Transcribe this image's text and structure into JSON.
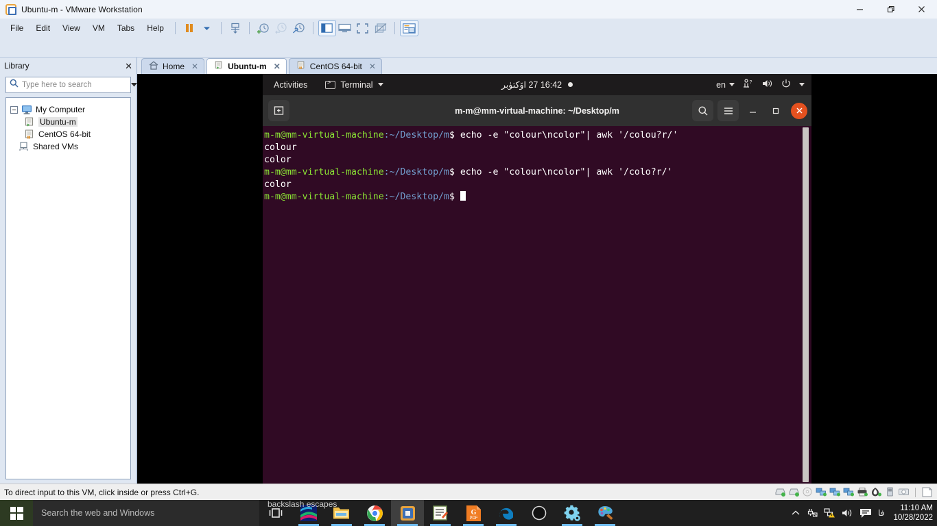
{
  "window": {
    "title": "Ubuntu-m - VMware Workstation",
    "icon": "vmware-icon",
    "controls": {
      "minimize": "minimize-icon",
      "restore": "restore-icon",
      "close": "close-icon"
    }
  },
  "menubar": {
    "items": [
      "File",
      "Edit",
      "View",
      "VM",
      "Tabs",
      "Help"
    ]
  },
  "toolbar": {
    "buttons": [
      {
        "name": "suspend-button",
        "icon": "pause-icon"
      },
      {
        "name": "power-dropdown-button",
        "icon": "chevron-down-icon"
      },
      {
        "name": "manage-snapshot-button",
        "icon": "snapshot-icon"
      },
      {
        "name": "take-snapshot-button",
        "icon": "snapshot-add-icon"
      },
      {
        "name": "revert-snapshot-button",
        "icon": "snapshot-revert-icon"
      },
      {
        "name": "snapshot-manager-button",
        "icon": "snapshot-manager-icon"
      },
      {
        "name": "show-library-button",
        "icon": "library-panel-icon"
      },
      {
        "name": "show-console-button",
        "icon": "console-view-icon"
      },
      {
        "name": "fullscreen-button",
        "icon": "fullscreen-icon"
      },
      {
        "name": "unity-mode-button",
        "icon": "unity-mode-icon"
      },
      {
        "name": "preferences-button",
        "icon": "preferences-icon"
      }
    ]
  },
  "library": {
    "title": "Library",
    "close_label": "✕",
    "search": {
      "placeholder": "Type here to search",
      "value": "",
      "icon": "search-icon",
      "dropdown_icon": "chevron-down-icon"
    },
    "tree": [
      {
        "label": "My Computer",
        "icon": "my-computer-icon",
        "level": 0,
        "expanded": true,
        "selected": false
      },
      {
        "label": "Ubuntu-m",
        "icon": "vm-running-icon",
        "level": 1,
        "selected": true
      },
      {
        "label": "CentOS 64-bit",
        "icon": "vm-suspended-icon",
        "level": 1,
        "selected": false
      },
      {
        "label": "Shared VMs",
        "icon": "shared-vms-icon",
        "level": 0,
        "selected": false
      }
    ]
  },
  "tabs": [
    {
      "label": "Home",
      "icon": "home-icon",
      "active": false,
      "close": "✕"
    },
    {
      "label": "Ubuntu-m",
      "icon": "vm-running-icon",
      "active": true,
      "close": "✕"
    },
    {
      "label": "CentOS 64-bit",
      "icon": "vm-suspended-icon",
      "active": false,
      "close": "✕"
    }
  ],
  "gnome": {
    "activities": "Activities",
    "app_menu": "Terminal",
    "app_icon": "terminal-icon",
    "clock": "16:42  27  اۆكتۈبر",
    "notification_dot": "notification-dot",
    "language": "en",
    "tray_icons": [
      "network-icon",
      "volume-icon",
      "power-icon",
      "chevron-down-icon"
    ]
  },
  "terminal": {
    "title": "m-m@mm-virtual-machine: ~/Desktop/m",
    "new_tab_icon": "new-tab-icon",
    "search_icon": "search-icon",
    "menu_icon": "hamburger-menu-icon",
    "minimize_icon": "minimize-icon",
    "maximize_icon": "maximize-icon",
    "close_icon": "close-icon",
    "prompt_user": "m-m@mm-virtual-machine",
    "prompt_path": ":~/Desktop/m",
    "prompt_sigil": "$",
    "lines": [
      {
        "type": "prompt",
        "command": " echo -e \"colour\\ncolor\"| awk '/colou?r/'"
      },
      {
        "type": "output",
        "text": "colour"
      },
      {
        "type": "output",
        "text": "color"
      },
      {
        "type": "prompt",
        "command": " echo -e \"colour\\ncolor\"| awk '/colo?r/'"
      },
      {
        "type": "output",
        "text": "color"
      },
      {
        "type": "prompt",
        "command": " ",
        "cursor": true
      }
    ]
  },
  "statusbar": {
    "message": "To direct input to this VM, click inside or press Ctrl+G.",
    "devices": [
      "hard-disk-icon",
      "hard-disk-icon",
      "cd-dvd-icon",
      "network-adapter-icon",
      "network-adapter-icon",
      "network-adapter-icon",
      "printer-icon",
      "sound-card-icon",
      "usb-icon",
      "camera-icon",
      "message-icon"
    ]
  },
  "taskbar": {
    "start_icon": "windows-start-icon",
    "search_placeholder": "Search the web and Windows",
    "overlay_text": "backslash escapes",
    "apps": [
      {
        "name": "task-view-button",
        "icon": "task-view-icon"
      },
      {
        "name": "colorful-app-button",
        "icon": "wallpaper-app-icon"
      },
      {
        "name": "file-explorer-button",
        "icon": "file-explorer-icon"
      },
      {
        "name": "chrome-button",
        "icon": "chrome-icon"
      },
      {
        "name": "vmware-button",
        "icon": "vmware-icon",
        "active": true
      },
      {
        "name": "editor-button",
        "icon": "notepad-icon"
      },
      {
        "name": "pdf-reader-button",
        "icon": "gpdf-icon"
      },
      {
        "name": "edge-button",
        "icon": "edge-icon"
      },
      {
        "name": "cortana-button",
        "icon": "cortana-icon"
      },
      {
        "name": "settings-button",
        "icon": "settings-gear-icon"
      },
      {
        "name": "paint-button",
        "icon": "paint-icon"
      }
    ],
    "tray": {
      "expand_icon": "chevron-up-icon",
      "device_icon": "unplugged-device-icon",
      "network_icon": "network-warning-icon",
      "volume_icon": "volume-icon",
      "action_center_icon": "action-center-icon",
      "language": "فا",
      "time": "11:10 AM",
      "date": "10/28/2022"
    }
  }
}
